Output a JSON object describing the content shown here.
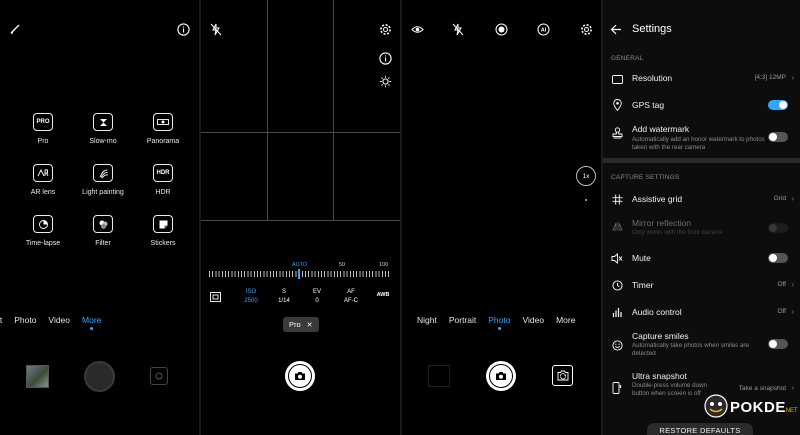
{
  "panel1": {
    "modes": [
      {
        "badge": "PRO",
        "label": "Pro",
        "icon": "pro-icon"
      },
      {
        "badge": "",
        "label": "Slow-mo",
        "icon": "slow-mo-icon"
      },
      {
        "badge": "",
        "label": "Panorama",
        "icon": "panorama-icon"
      },
      {
        "badge": "AR",
        "label": "AR lens",
        "icon": "ar-lens-icon"
      },
      {
        "badge": "",
        "label": "Light painting",
        "icon": "light-painting-icon"
      },
      {
        "badge": "HDR",
        "label": "HDR",
        "icon": "hdr-icon"
      },
      {
        "badge": "",
        "label": "Time-lapse",
        "icon": "time-lapse-icon"
      },
      {
        "badge": "",
        "label": "Filter",
        "icon": "filter-icon"
      },
      {
        "badge": "",
        "label": "Stickers",
        "icon": "stickers-icon"
      }
    ],
    "tabs": [
      "rt",
      "Photo",
      "Video",
      "More"
    ],
    "active_tab": "More"
  },
  "panel2": {
    "scale_labels": [
      "AUTO",
      "50",
      "100"
    ],
    "params": [
      {
        "name": "ISO",
        "value": "2500"
      },
      {
        "name": "S",
        "value": "1/14"
      },
      {
        "name": "EV",
        "value": "0"
      },
      {
        "name": "AF",
        "value": "AF-C"
      },
      {
        "name": "AWB",
        "value": ""
      }
    ],
    "chip_label": "Pro",
    "chip_close": "✕"
  },
  "panel3": {
    "zoom": "1x",
    "tabs": [
      "Night",
      "Portrait",
      "Photo",
      "Video",
      "More"
    ],
    "active_tab": "Photo"
  },
  "settings": {
    "title": "Settings",
    "general_header": "GENERAL",
    "capture_header": "CAPTURE SETTINGS",
    "resolution_label": "Resolution",
    "resolution_value": "[4:3] 12MP",
    "gps_label": "GPS tag",
    "gps_on": true,
    "watermark_label": "Add watermark",
    "watermark_sub": "Automatically add an honor watermark to photos taken with the rear camera",
    "grid_label": "Assistive grid",
    "grid_value": "Grid",
    "mirror_label": "Mirror reflection",
    "mirror_sub": "Only works with the front camera",
    "mute_label": "Mute",
    "timer_label": "Timer",
    "timer_value": "Off",
    "audio_label": "Audio control",
    "audio_value": "Off",
    "smiles_label": "Capture smiles",
    "smiles_sub": "Automatically take photos when smiles are detected",
    "ultra_label": "Ultra snapshot",
    "ultra_sub": "Double-press volume down button when screen is off",
    "ultra_value": "Take a snapshot",
    "restore_label": "RESTORE DEFAULTS",
    "watermark_logo": "POKDE.NET"
  },
  "colors": {
    "accent": "#2ea7ff",
    "background": "#000000"
  }
}
